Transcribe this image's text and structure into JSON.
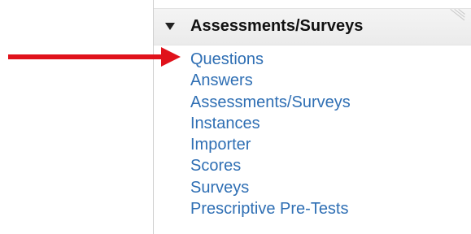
{
  "panel": {
    "title": "Assessments/Surveys",
    "links": [
      "Questions",
      "Answers",
      "Assessments/Surveys",
      "Instances",
      "Importer",
      "Scores",
      "Surveys",
      "Prescriptive Pre-Tests"
    ]
  },
  "colors": {
    "link": "#2f6fb4",
    "arrow": "#e0121b",
    "header_bg": "#eeeeee"
  },
  "icons": {
    "header_toggle": "collapse-triangle-icon",
    "annotation": "red-arrow-icon"
  }
}
